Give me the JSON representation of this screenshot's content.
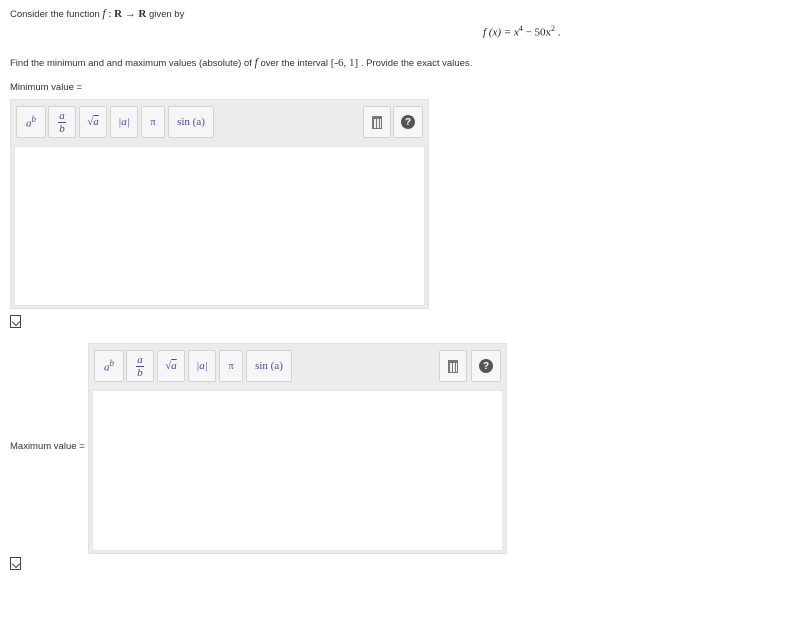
{
  "problem": {
    "intro": "Consider the function",
    "f_sym": "f",
    "colon": ":",
    "domain": "R",
    "arrow": "→",
    "codomain": "R",
    "given_by": "given by",
    "formula_lhs": "f (x) = x",
    "exp1": "4",
    "formula_mid": " − 50x",
    "exp2": "2",
    "formula_end": " .",
    "instruction_a": "Find the minimum and and maximum values (absolute) of",
    "instruction_f": "f",
    "instruction_b": "over the interval",
    "interval": "[-6, 1]",
    "instruction_c": ". Provide the exact values."
  },
  "min_label": "Minimum value =",
  "max_label": "Maximum value =",
  "toolbar": {
    "power_base": "a",
    "power_exp": "b",
    "frac_num": "a",
    "frac_den": "b",
    "sqrt_sym": "√",
    "sqrt_arg": "a",
    "abs": "|a|",
    "pi": "π",
    "sin": "sin (a)",
    "help": "?"
  },
  "icons": [
    "power-icon",
    "fraction-icon",
    "sqrt-icon",
    "abs-icon",
    "pi-icon",
    "sin-icon",
    "trash-icon",
    "help-icon",
    "document-check-icon"
  ]
}
